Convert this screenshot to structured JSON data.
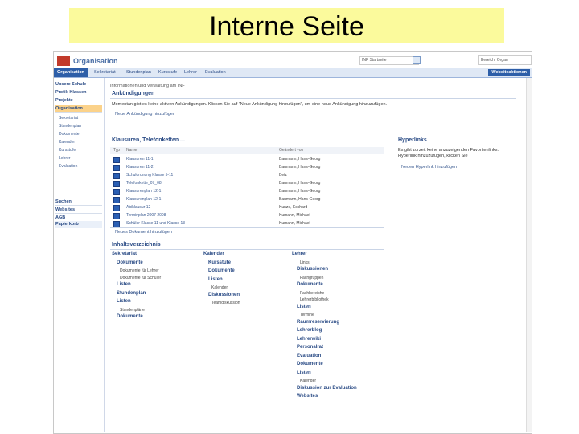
{
  "slide": {
    "title": "Interne Seite"
  },
  "top": {
    "site_title": "Organisation",
    "site_dropdown": "INF Startseite",
    "search_placeholder": "Bereich: Organ"
  },
  "nav": {
    "tabs": [
      "Organisation",
      "Sekretariat",
      "Stundenplan",
      "Kursstufe",
      "Lehrer",
      "Evaluation"
    ],
    "site_actions": "Websiteaktionen"
  },
  "left_nav": {
    "headings": [
      "Unsere Schule",
      "Profil: Klassen",
      "Projekte",
      "Organisation"
    ],
    "sub_items": [
      "Sekretariat",
      "Stundenplan",
      "Dokumente",
      "Kalender",
      "Kursstufe",
      "Lehrer",
      "Evaluation"
    ],
    "lower_headings": [
      "Suchen",
      "Websites",
      "AGB"
    ],
    "recycle": "Papierkorb"
  },
  "main": {
    "breadcrumb": "Informationen und Verwaltung am INF",
    "announcements_title": "Ankündigungen",
    "announcements_text": "Momentan gibt es keine aktiven Ankündigungen. Klicken Sie auf \"Neue Ankündigung hinzufügen\", um eine neue Ankündigung hinzuzufügen.",
    "add_announcement": "Neue Ankündigung hinzufügen",
    "docs_title": "Klausuren, Telefonketten ...",
    "docs_headers": [
      "Typ",
      "Name",
      "Geändert von"
    ],
    "docs_rows": [
      {
        "name": "Klausuren 11-1",
        "by": "Baumann, Hans-Georg"
      },
      {
        "name": "Klausuren 11-2",
        "by": "Baumann, Hans-Georg"
      },
      {
        "name": "Schulordnung Klasse 5-11",
        "by": "Betz"
      },
      {
        "name": "Telefonkette_07_08",
        "by": "Baumann, Hans-Georg"
      },
      {
        "name": "Klausurenplan 12-1",
        "by": "Baumann, Hans-Georg"
      },
      {
        "name": "Klausurenplan 12-1",
        "by": "Baumann, Hans-Georg"
      },
      {
        "name": "Abiklausur 12",
        "by": "Kunze, Eckhard"
      },
      {
        "name": "Terminplan 2007 2008",
        "by": "Kumann, Michael"
      },
      {
        "name": "Schüler Klasse 11 und Klasse 13",
        "by": "Kumann, Michael"
      }
    ],
    "add_document": "Neues Dokument hinzufügen",
    "links_title": "Hyperlinks",
    "links_text_1": "Es gibt zurzeit keine anzuzeigenden Favoritenlinks.",
    "links_text_2": "Hyperlink hinzuzufügen, klicken Sie",
    "add_link": "Neuen Hyperlink hinzufügen",
    "toc_title": "Inhaltsverzeichnis",
    "toc": {
      "col1": [
        {
          "t": "Sekretariat",
          "k": "h"
        },
        {
          "t": "Dokumente",
          "k": "h"
        },
        {
          "t": "Dokumente für Lehrer",
          "k": "s"
        },
        {
          "t": "Dokumente für Schüler",
          "k": "s"
        },
        {
          "t": "Listen",
          "k": "h"
        },
        {
          "t": "Stundenplan",
          "k": "h"
        },
        {
          "t": "Listen",
          "k": "h"
        },
        {
          "t": "Stundenpläne",
          "k": "s"
        },
        {
          "t": "Dokumente",
          "k": "h"
        }
      ],
      "col2": [
        {
          "t": "Kalender",
          "k": "h"
        },
        {
          "t": "Kursstufe",
          "k": "h"
        },
        {
          "t": "Dokumente",
          "k": "h"
        },
        {
          "t": "Listen",
          "k": "h"
        },
        {
          "t": "Kalender",
          "k": "s"
        },
        {
          "t": "Diskussionen",
          "k": "h"
        },
        {
          "t": "Teamdiskussion",
          "k": "s"
        }
      ],
      "col3": [
        {
          "t": "Lehrer",
          "k": "h"
        },
        {
          "t": "Links",
          "k": "s"
        },
        {
          "t": "Diskussionen",
          "k": "h"
        },
        {
          "t": "Fachgruppen",
          "k": "s"
        },
        {
          "t": "Dokumente",
          "k": "h"
        },
        {
          "t": "Fachbereiche",
          "k": "s"
        },
        {
          "t": "Lehrerbibliothek",
          "k": "s"
        },
        {
          "t": "Listen",
          "k": "h"
        },
        {
          "t": "Termine",
          "k": "s"
        },
        {
          "t": "Raumreservierung",
          "k": "h"
        },
        {
          "t": "Lehrerblog",
          "k": "h"
        },
        {
          "t": "Lehrerwiki",
          "k": "h"
        },
        {
          "t": "Personalrat",
          "k": "h"
        },
        {
          "t": "Evaluation",
          "k": "h"
        },
        {
          "t": "Dokumente",
          "k": "h"
        },
        {
          "t": "Listen",
          "k": "h"
        },
        {
          "t": "Kalender",
          "k": "s"
        },
        {
          "t": "Diskussion zur Evaluation",
          "k": "h"
        },
        {
          "t": "Websites",
          "k": "h"
        }
      ]
    }
  }
}
